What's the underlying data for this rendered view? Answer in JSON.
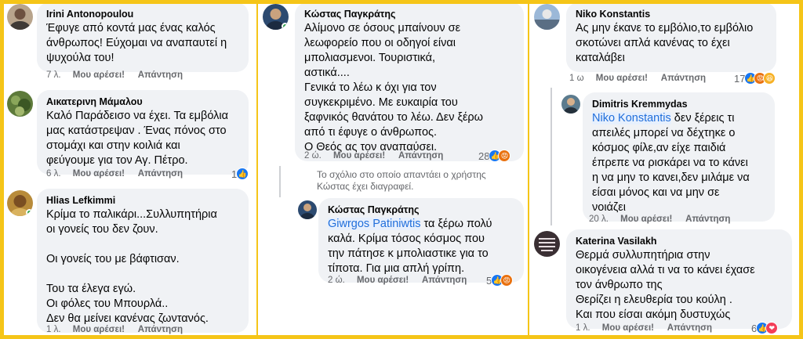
{
  "comments": {
    "irini": {
      "name": "Irini Antonopoulou",
      "text": "Έφυγε από κοντά μας ένας καλός\nάνθρωπος! Εύχομαι να αναπαυτεί η\nψυχούλα του!",
      "time": "7 λ.",
      "like": "Μου αρέσει!",
      "reply": "Απάντηση"
    },
    "aikaterini": {
      "name": "Αικατερινη Μάμαλου",
      "text": "Καλό Παράδεισο να έχει. Τα εμβόλια\nμας κατάστρεψαν . Ένας πόνος στο\nστομάχι και στην κοιλιά και\nφεύγουμε για τον Αγ. Πέτρο.",
      "time": "6 λ.",
      "like": "Μου αρέσει!",
      "reply": "Απάντηση",
      "reactions": "1"
    },
    "hlias": {
      "name": "Hlias Lefkimmi",
      "text": "Κρίμα το παλικάρι...Συλλυπητήρια\nοι γονείς του δεν ζουν.\n\nΟι γονείς του με βάφτισαν.\n\nΤου τα έλεγα εγώ.\nΟι φόλες του Μπουρλά..\nΔεν θα μείνει κανένας ζωντανός.",
      "time": "1 λ.",
      "like": "Μου αρέσει!",
      "reply": "Απάντηση"
    },
    "kostas1": {
      "name": "Κώστας Παγκράτης",
      "text": "Αλίμονο σε όσους μπαίνουν σε\nλεωφορείο που οι οδηγοί είναι\nμπολιασμενοι. Τουριστικά,\nαστικά....\nΓενικά το λέω κ όχι για τον\nσυγκεκριμένο. Με ευκαιρία του\nξαφνικός θανάτου το λέω. Δεν ξέρω\nαπό τι έφυγε ο άνθρωπος.\nΟ Θεός ας τον αναπαύσει.",
      "time": "2 ώ.",
      "like": "Μου αρέσει!",
      "reply": "Απάντηση",
      "reactions": "28"
    },
    "deleted_notice": "Το σχόλιο στο οποίο απαντάει ο χρήστης\nΚώστας έχει διαγραφεί.",
    "kostas2": {
      "name": "Κώστας Παγκράτης",
      "mention": "Giwrgos Patiniwtis",
      "text": " τα ξέρω πολύ\nκαλά. Κρίμα τόσος κόσμος που\nτην πάτησε κ μπολιαστικε για το\nτίποτα. Για μια απλή γρίπη.",
      "time": "2 ώ.",
      "like": "Μου αρέσει!",
      "reply": "Απάντηση",
      "reactions": "5"
    },
    "niko": {
      "name": "Niko Konstantis",
      "text": "Ας μην έκανε το εμβόλιο,το εμβόλιο\nσκοτώνει απλά κανένας το έχει\nκαταλάβει",
      "time": "1 ω",
      "like": "Μου αρέσει!",
      "reply": "Απάντηση",
      "reactions": "17"
    },
    "dimitris": {
      "name": "Dimitris Kremmydas",
      "mention": "Niko Konstantis",
      "text": " δεν ξέρεις τι\nαπειλές μπορεί να δέχτηκε ο\nκόσμος φίλε,αν είχε παιδιά\nέπρεπε να ρισκάρει να το κάνει\nη να μην το κανει,δεν μιλάμε να\nείσαι μόνος και να μην σε\nνοιάζει",
      "time": "20 λ.",
      "like": "Μου αρέσει!",
      "reply": "Απάντηση"
    },
    "katerina": {
      "name": "Katerina Vasilakh",
      "text": "Θερμά συλλυπητήρια στην\nοικογένεια αλλά τι να το κάνει έχασε\nτον άνθρωπο της\nΘερίζει η ελευθερία του κούλη .\nΚαι που είσαι ακόμη δυστυχώς",
      "time": "1 λ.",
      "like": "Μου αρέσει!",
      "reply": "Απάντηση",
      "reactions": "6"
    }
  },
  "icons": {
    "like": "like-icon",
    "angry": "angry-icon",
    "haha": "haha-icon",
    "love": "love-icon"
  },
  "colors": {
    "frame": "#f5c518",
    "bubble": "#f0f2f5",
    "mention": "#216fdb",
    "like": "#1877f2",
    "angry": "#e9710f",
    "haha": "#f7b125",
    "love": "#f33e58",
    "online": "#31a24c"
  }
}
